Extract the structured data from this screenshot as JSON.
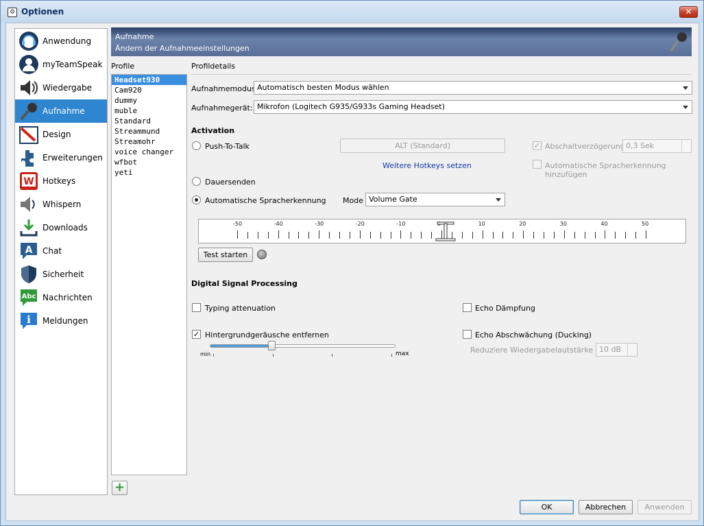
{
  "window": {
    "title": "Optionen",
    "close_label": "✕"
  },
  "sidebar": {
    "items": [
      {
        "label": "Anwendung",
        "icon": "headset-icon"
      },
      {
        "label": "myTeamSpeak",
        "icon": "user-icon"
      },
      {
        "label": "Wiedergabe",
        "icon": "speaker-icon"
      },
      {
        "label": "Aufnahme",
        "icon": "microphone-icon",
        "active": true
      },
      {
        "label": "Design",
        "icon": "design-icon"
      },
      {
        "label": "Erweiterungen",
        "icon": "puzzle-icon"
      },
      {
        "label": "Hotkeys",
        "icon": "hotkey-icon"
      },
      {
        "label": "Whispern",
        "icon": "whisper-icon"
      },
      {
        "label": "Downloads",
        "icon": "download-icon"
      },
      {
        "label": "Chat",
        "icon": "chat-icon"
      },
      {
        "label": "Sicherheit",
        "icon": "shield-icon"
      },
      {
        "label": "Nachrichten",
        "icon": "message-icon"
      },
      {
        "label": "Meldungen",
        "icon": "info-icon"
      }
    ]
  },
  "header": {
    "title": "Aufnahme",
    "subtitle": "Ändern der Aufnahmeeinstellungen"
  },
  "profiles": {
    "label": "Profile",
    "items": [
      "Headset930",
      "Cam920",
      "dummy",
      "muble",
      "Standard",
      "Streammund",
      "Streamohr",
      "voice changer",
      "wfbot",
      "yeti"
    ],
    "selected": "Headset930",
    "add_label": "+"
  },
  "details": {
    "label": "Profildetails",
    "mode_label": "Aufnahmemodus:",
    "mode_value": "Automatisch besten Modus wählen",
    "device_label": "Aufnahmegerät:",
    "device_value": "Mikrofon (Logitech G935/G933s Gaming Headset)"
  },
  "activation": {
    "title": "Activation",
    "ptt_label": "Push-To-Talk",
    "ptt_key_label": "ALT (Standard)",
    "release_delay_label": "Abschaltverzögerung:",
    "release_delay_value": "0,3 Sek",
    "more_hotkeys_label": "Weitere Hotkeys setzen",
    "auto_detect_add_label": "Automatische Spracherkennung hinzufügen",
    "continuous_label": "Dauersenden",
    "vad_label": "Automatische Spracherkennung",
    "vad_mode_label": "Mode",
    "vad_mode_value": "Volume Gate",
    "selected": "vad"
  },
  "meter": {
    "tick_labels": [
      "-50",
      "-40",
      "-30",
      "-20",
      "-10",
      "0",
      "10",
      "20",
      "30",
      "40",
      "50"
    ],
    "threshold_value": 1,
    "test_button_label": "Test starten"
  },
  "dsp": {
    "title": "Digital Signal Processing",
    "typing_label": "Typing attenuation",
    "typing_checked": false,
    "echo_label": "Echo Dämpfung",
    "echo_checked": false,
    "noise_label": "Hintergrundgeräusche entfernen",
    "noise_checked": true,
    "noise_level": 0.33,
    "noise_min_label": "min",
    "noise_max_label": "max",
    "ducking_label": "Echo Abschwächung (Ducking)",
    "ducking_checked": false,
    "ducking_reduce_label": "Reduziere Wiedergabelautstärke um:",
    "ducking_reduce_value": "10 dB"
  },
  "footer": {
    "ok_label": "OK",
    "cancel_label": "Abbrechen",
    "apply_label": "Anwenden"
  },
  "colors": {
    "accent": "#2f86d0",
    "header": "#5a6f98",
    "active_text": "#ffffff"
  }
}
